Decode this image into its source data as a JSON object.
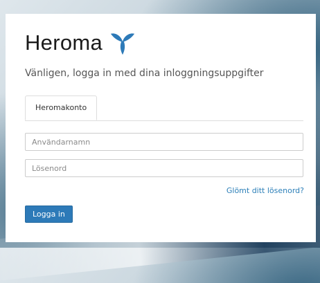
{
  "brand": {
    "name": "Heroma",
    "logo_icon": "heroma-bird-icon",
    "logo_color": "#2d7ab8"
  },
  "login": {
    "subtitle": "Vänligen, logga in med dina inloggningsuppgifter",
    "tabs": [
      {
        "label": "Heromakonto",
        "active": true
      }
    ],
    "username": {
      "value": "",
      "placeholder": "Användarnamn"
    },
    "password": {
      "value": "",
      "placeholder": "Lösenord"
    },
    "forgot_link": "Glömt ditt lösenord?",
    "submit_label": "Logga in"
  }
}
